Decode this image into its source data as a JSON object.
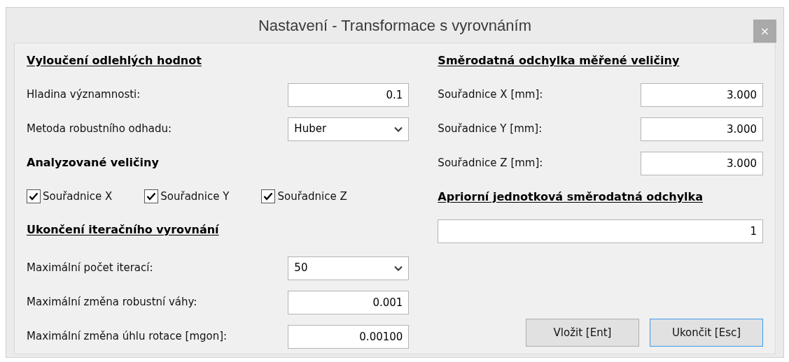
{
  "window": {
    "title": "Nastavení - Transformace s vyrovnáním",
    "close": "×"
  },
  "left": [
    {
      "kind": "heading",
      "text": "Vyloučení odlehlých hodnot",
      "underlined": true
    },
    {
      "kind": "field",
      "label": "Hladina významnosti:",
      "value": "0.1"
    },
    {
      "kind": "dropdown",
      "label": "Metoda robustního odhadu:",
      "value": "Huber"
    },
    {
      "kind": "heading",
      "text": "Analyzované veličiny",
      "underlined": false
    },
    {
      "kind": "checkboxes",
      "items": [
        {
          "label": "Souřadnice X",
          "checked": true
        },
        {
          "label": "Souřadnice Y",
          "checked": true
        },
        {
          "label": "Souřadnice Z",
          "checked": true
        }
      ]
    },
    {
      "kind": "heading",
      "text": "Ukončení iteračního vyrovnání",
      "underlined": true
    },
    {
      "kind": "dropdown",
      "label": "Maximální počet iterací:",
      "value": "50"
    },
    {
      "kind": "field",
      "label": "Maximální změna robustní váhy:",
      "value": "0.001"
    },
    {
      "kind": "field",
      "label": "Maximální změna úhlu rotace [mgon]:",
      "value": "0.00100"
    }
  ],
  "right": [
    {
      "kind": "heading",
      "text": "Směrodatná odchylka měřené veličiny",
      "underlined": true
    },
    {
      "kind": "field",
      "label": "Souřadnice X [mm]:",
      "value": "3.000"
    },
    {
      "kind": "field",
      "label": "Souřadnice Y [mm]:",
      "value": "3.000"
    },
    {
      "kind": "field",
      "label": "Souřadnice Z [mm]:",
      "value": "3.000"
    },
    {
      "kind": "heading",
      "text": "Apriorní jednotková směrodatná odchylka",
      "underlined": true
    },
    {
      "kind": "widefield",
      "value": "1"
    }
  ],
  "buttons": [
    {
      "label": "Vložit [Ent]",
      "focused": false
    },
    {
      "label": "Ukončit [Esc]",
      "focused": true
    }
  ]
}
